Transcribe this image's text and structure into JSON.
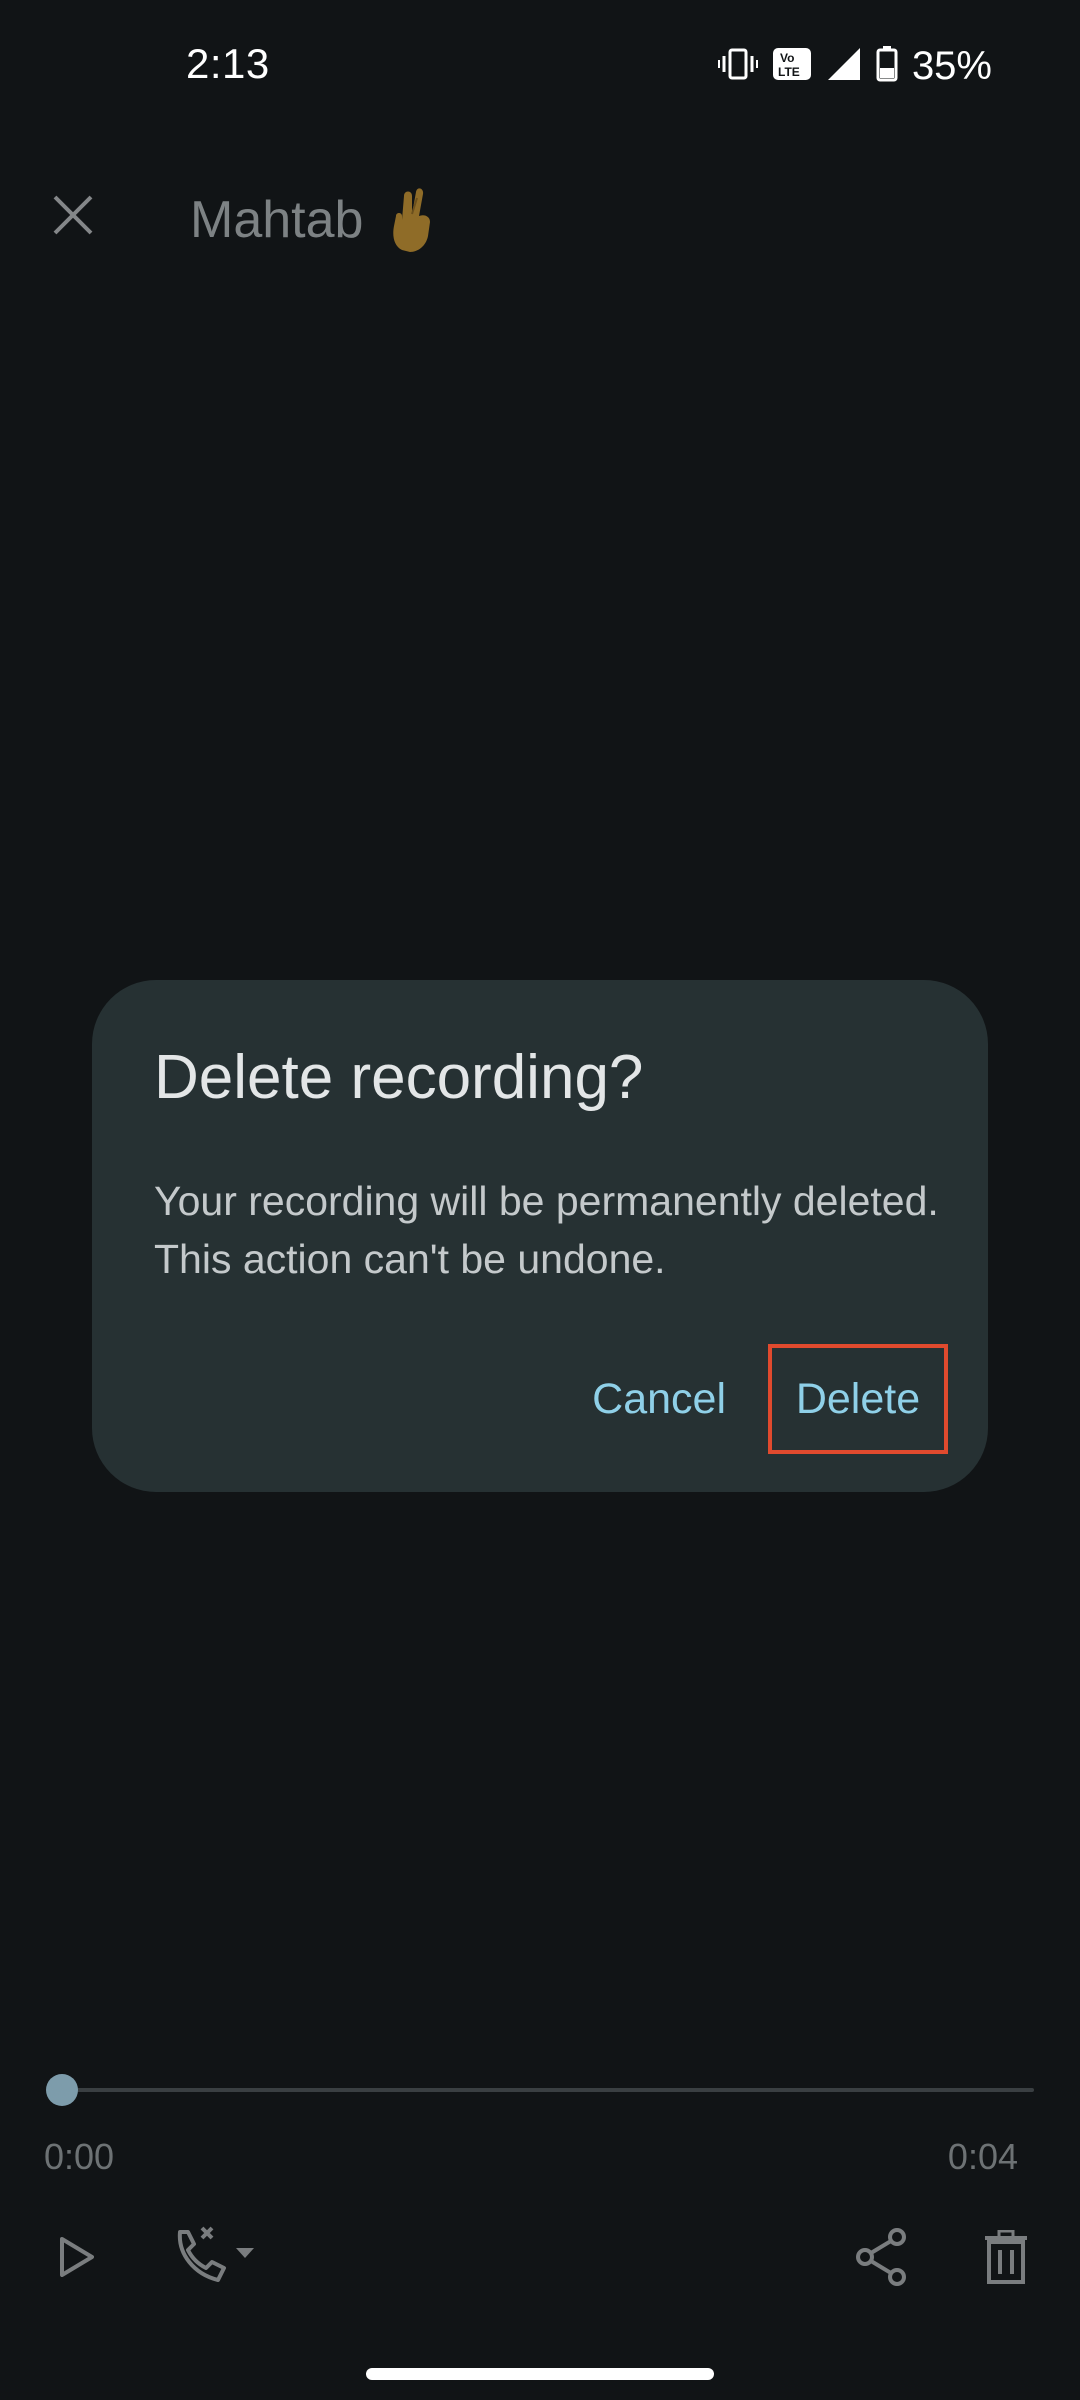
{
  "status_bar": {
    "time": "2:13",
    "network_badge": "Vo LTE",
    "battery_percent": "35%",
    "icons": [
      "vibrate-icon",
      "volte-icon",
      "signal-icon",
      "battery-icon"
    ]
  },
  "top_bar": {
    "close_icon": "close-icon",
    "title": "Mahtab",
    "title_emoji_icon": "crossed-fingers-icon"
  },
  "dialog": {
    "title": "Delete recording?",
    "body": "Your recording will be permanently deleted. This action can't be undone.",
    "cancel_label": "Cancel",
    "delete_label": "Delete",
    "highlight_color": "#e04a2e",
    "accent_color": "#8fd0e8"
  },
  "player": {
    "time_start": "0:00",
    "time_end": "0:04",
    "progress_fraction": 0,
    "controls": [
      "play-icon",
      "call-audio-route-icon",
      "share-icon",
      "trash-icon"
    ]
  }
}
